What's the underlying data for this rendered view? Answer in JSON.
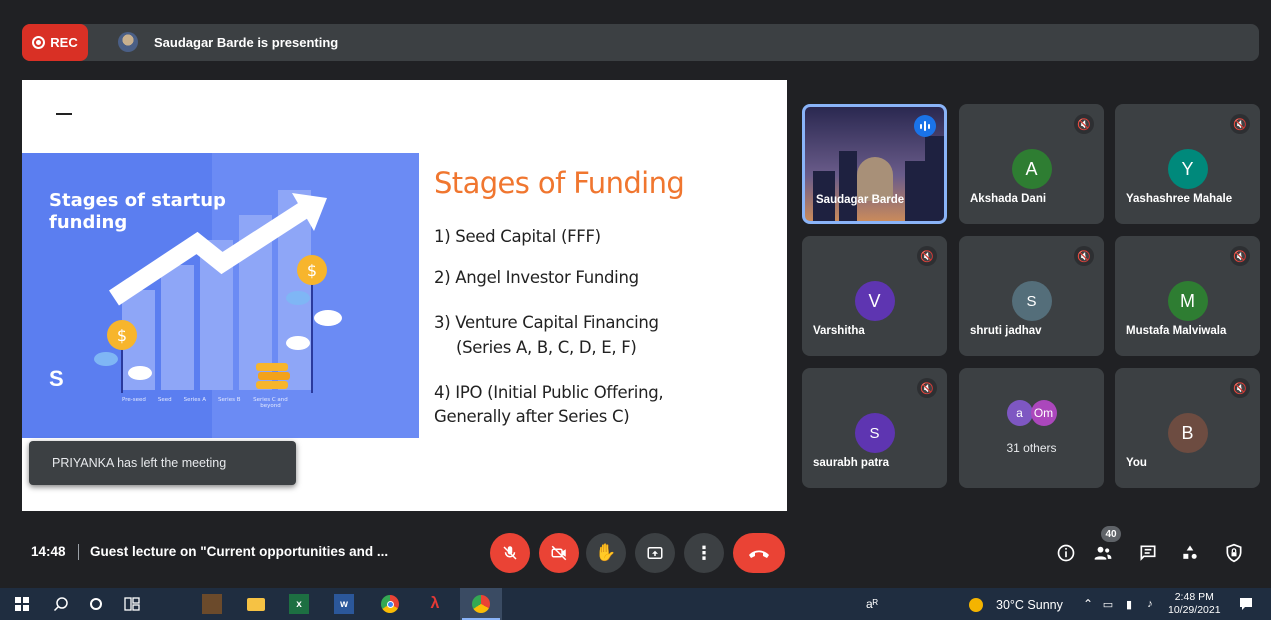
{
  "banner": {
    "rec_label": "REC",
    "presenting_text": "Saudagar Barde is presenting"
  },
  "slide": {
    "image_title_line1": "Stages of startup",
    "image_title_line2": "funding",
    "logo_glyph": "S",
    "stage_labels": [
      "Pre-seed",
      "Seed",
      "Series A",
      "Series B",
      "Series C and beyond"
    ],
    "heading": "Stages of Funding",
    "items": [
      "1) Seed Capital (FFF)",
      "2) Angel Investor Funding",
      "3) Venture Capital Financing",
      "(Series A, B, C, D, E, F)",
      "4) IPO (Initial Public Offering,",
      "Generally after Series C)"
    ]
  },
  "toast": {
    "text": "PRIYANKA has left the meeting"
  },
  "participants": [
    {
      "name": "Saudagar Barde",
      "initial": "",
      "color": ""
    },
    {
      "name": "Akshada Dani",
      "initial": "A",
      "color": "#2e7d32"
    },
    {
      "name": "Yashashree Mahale",
      "initial": "Y",
      "color": "#00897b"
    },
    {
      "name": "Varshitha",
      "initial": "V",
      "color": "#5e35b1"
    },
    {
      "name": "shruti jadhav",
      "initial": "S",
      "color": "#546e7a"
    },
    {
      "name": "Mustafa Malviwala",
      "initial": "M",
      "color": "#2e7d32"
    },
    {
      "name": "saurabh patra",
      "initial": "S",
      "color": "#5e35b1"
    },
    {
      "name": "",
      "initial": "",
      "color": ""
    },
    {
      "name": "You",
      "initial": "B",
      "color": "#6d4c41"
    }
  ],
  "others_tile": {
    "avatar1": "a",
    "avatar2": "Om",
    "avatar1_color": "#7e57c2",
    "avatar2_color": "#ab47bc",
    "label": "31 others"
  },
  "meeting": {
    "time": "14:48",
    "title": "Guest lecture on \"Current opportunities and ...",
    "participant_count": "40"
  },
  "taskbar": {
    "weather": "30°C  Sunny",
    "time": "2:48 PM",
    "date": "10/29/2021"
  },
  "colors": {
    "accent_blue": "#8ab4f8",
    "danger_red": "#ea4335",
    "slide_heading_orange": "#f0762f"
  }
}
